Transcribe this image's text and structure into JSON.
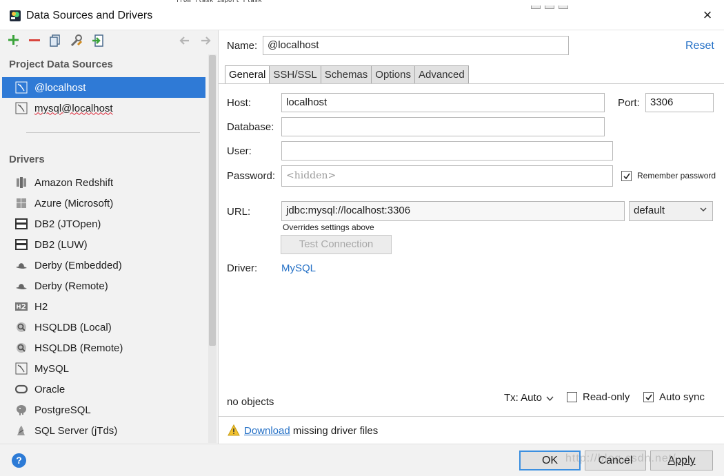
{
  "window": {
    "title": "Data Sources and Drivers",
    "close_label": "×",
    "code_strip": "from flask import Flask"
  },
  "left": {
    "project_title": "Project Data Sources",
    "data_sources": [
      {
        "label": "@localhost",
        "selected": true
      },
      {
        "label": "mysql@localhost",
        "selected": false
      }
    ],
    "drivers_title": "Drivers",
    "drivers": [
      {
        "label": "Amazon Redshift",
        "icon": "redshift-icon"
      },
      {
        "label": "Azure (Microsoft)",
        "icon": "windows-icon"
      },
      {
        "label": "DB2 (JTOpen)",
        "icon": "ibm-db2-icon"
      },
      {
        "label": "DB2 (LUW)",
        "icon": "ibm-db2-icon"
      },
      {
        "label": "Derby (Embedded)",
        "icon": "derby-hat-icon"
      },
      {
        "label": "Derby (Remote)",
        "icon": "derby-hat-icon"
      },
      {
        "label": "H2",
        "icon": "h2-icon"
      },
      {
        "label": "HSQLDB (Local)",
        "icon": "hsqldb-icon"
      },
      {
        "label": "HSQLDB (Remote)",
        "icon": "hsqldb-icon"
      },
      {
        "label": "MySQL",
        "icon": "mysql-icon"
      },
      {
        "label": "Oracle",
        "icon": "oracle-icon"
      },
      {
        "label": "PostgreSQL",
        "icon": "postgresql-elephant-icon"
      },
      {
        "label": "SQL Server (jTds)",
        "icon": "sqlserver-icon"
      }
    ]
  },
  "form": {
    "name_label": "Name:",
    "name_value": "@localhost",
    "reset_label": "Reset",
    "tabs": [
      "General",
      "SSH/SSL",
      "Schemas",
      "Options",
      "Advanced"
    ],
    "active_tab": "General",
    "host_label": "Host:",
    "host_value": "localhost",
    "port_label": "Port:",
    "port_value": "3306",
    "database_label": "Database:",
    "database_value": "",
    "user_label": "User:",
    "user_value": "",
    "password_label": "Password:",
    "password_placeholder": "<hidden>",
    "remember_password_label": "Remember password",
    "remember_password_checked": true,
    "url_label": "URL:",
    "url_value": "jdbc:mysql://localhost:3306",
    "url_mode": "default",
    "url_hint": "Overrides settings above",
    "test_connection_label": "Test Connection",
    "driver_label": "Driver:",
    "driver_value": "MySQL"
  },
  "status": {
    "objects_text": "no objects",
    "tx_label": "Tx: Auto",
    "readonly_label": "Read-only",
    "readonly_checked": false,
    "autosync_label": "Auto sync",
    "autosync_checked": true
  },
  "warning": {
    "link_text": "Download",
    "rest_text": "missing driver files"
  },
  "footer": {
    "help_label": "?",
    "ok_label": "OK",
    "cancel_label": "Cancel",
    "apply_label": "Apply",
    "watermark": "http://blog.csdn.net/..."
  },
  "colors": {
    "selection": "#2f7ad6",
    "link": "#2470c6",
    "add_green": "#3aa33a",
    "remove_red": "#d9453d"
  }
}
